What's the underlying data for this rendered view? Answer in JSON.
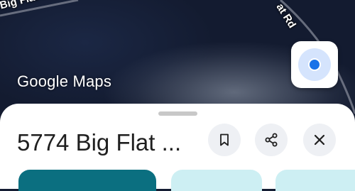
{
  "map": {
    "road_left_label": "Big Flat Rd",
    "road_right_label": "at Rd",
    "logo_text": "Google Maps",
    "locate_icon": "my-location-dot-icon"
  },
  "sheet": {
    "title": "5774 Big Flat ...",
    "actions": {
      "save_icon": "bookmark-icon",
      "share_icon": "share-icon",
      "close_icon": "close-icon"
    }
  },
  "colors": {
    "accent_teal": "#0b6f80",
    "chip_light": "#cdeff3",
    "location_blue": "#1a73e8",
    "action_button_bg": "#eef0f4"
  }
}
